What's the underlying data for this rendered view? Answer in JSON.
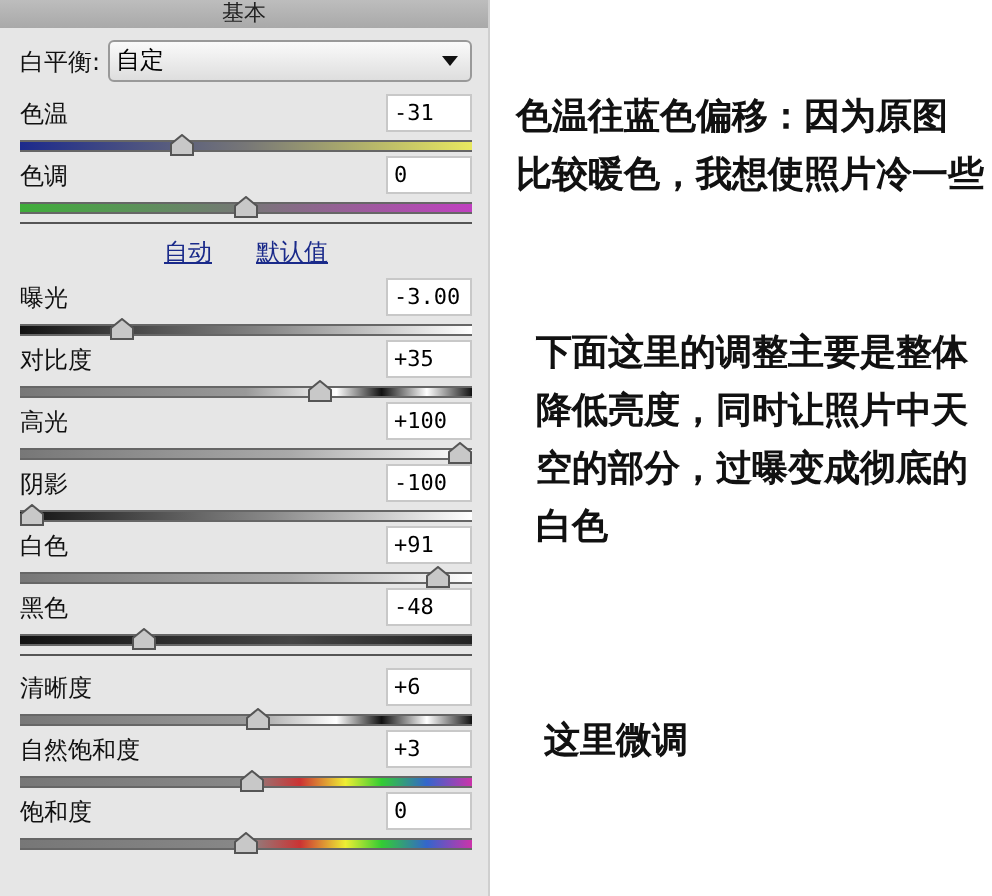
{
  "panel": {
    "title": "基本",
    "white_balance": {
      "label": "白平衡:",
      "value": "自定"
    },
    "color_sliders": [
      {
        "label": "色温",
        "value": "-31",
        "level": 0.35,
        "kind": "temperature"
      },
      {
        "label": "色调",
        "value": "0",
        "level": 0.5,
        "kind": "tint"
      }
    ],
    "links": [
      "自动",
      "默认值"
    ],
    "tone_sliders": [
      {
        "label": "曝光",
        "value": "-3.00",
        "level": 0.21,
        "kind": "tone"
      },
      {
        "label": "对比度",
        "value": "+35",
        "level": 0.675,
        "kind": "contrast"
      },
      {
        "label": "高光",
        "value": "+100",
        "level": 1,
        "kind": "grey"
      },
      {
        "label": "阴影",
        "value": "-100",
        "level": 0,
        "kind": "tone"
      },
      {
        "label": "白色",
        "value": "+91",
        "level": 0.95,
        "kind": "grey"
      },
      {
        "label": "黑色",
        "value": "-48",
        "level": 0.26,
        "kind": "dark"
      }
    ],
    "presence_sliders": [
      {
        "label": "清晰度",
        "value": "+6",
        "level": 0.53,
        "kind": "contrast"
      },
      {
        "label": "自然饱和度",
        "value": "+3",
        "level": 0.515,
        "kind": "saturation"
      },
      {
        "label": "饱和度",
        "value": "0",
        "level": 0.5,
        "kind": "saturation"
      }
    ]
  },
  "notes": [
    {
      "lines": [
        "色温往蓝色偏移：因为原图",
        "比较暖色，我想使照片冷一些"
      ]
    },
    {
      "lines": [
        "下面这里的调整主要是整体",
        "降低亮度，同时让照片中天",
        "空的部分，过曝变成彻底的",
        "白色"
      ]
    },
    {
      "lines": [
        "这里微调"
      ]
    }
  ]
}
